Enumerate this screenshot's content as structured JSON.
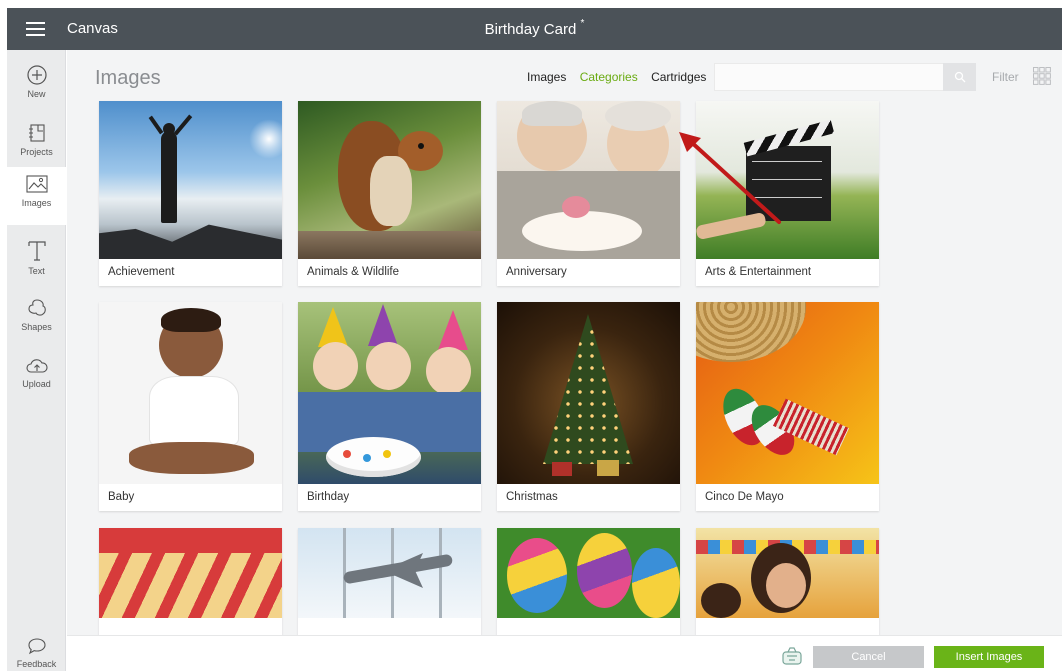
{
  "header": {
    "app_title": "Canvas",
    "document_title": "Birthday Card",
    "unsaved_marker": "*"
  },
  "sidebar": {
    "items": [
      {
        "label": "New",
        "icon": "plus-circle-icon"
      },
      {
        "label": "Projects",
        "icon": "projects-icon"
      },
      {
        "label": "Images",
        "icon": "images-icon",
        "active": true
      },
      {
        "label": "Text",
        "icon": "text-icon"
      },
      {
        "label": "Shapes",
        "icon": "shapes-icon"
      },
      {
        "label": "Upload",
        "icon": "upload-cloud-icon"
      }
    ],
    "feedback_label": "Feedback"
  },
  "main": {
    "title": "Images",
    "tabs": [
      {
        "label": "Images",
        "active": false
      },
      {
        "label": "Categories",
        "active": true
      },
      {
        "label": "Cartridges",
        "active": false
      }
    ],
    "search_placeholder": "",
    "filter_label": "Filter",
    "categories": [
      "Achievement",
      "Animals & Wildlife",
      "Anniversary",
      "Arts & Entertainment",
      "Baby",
      "Birthday",
      "Christmas",
      "Cinco De Mayo",
      "",
      "",
      "",
      ""
    ]
  },
  "footer": {
    "cancel_label": "Cancel",
    "insert_label": "Insert Images"
  },
  "colors": {
    "topbar": "#4b5258",
    "accent_green": "#6aab12",
    "insert_button": "#6ab418",
    "annotation_arrow": "#c11a1a"
  }
}
